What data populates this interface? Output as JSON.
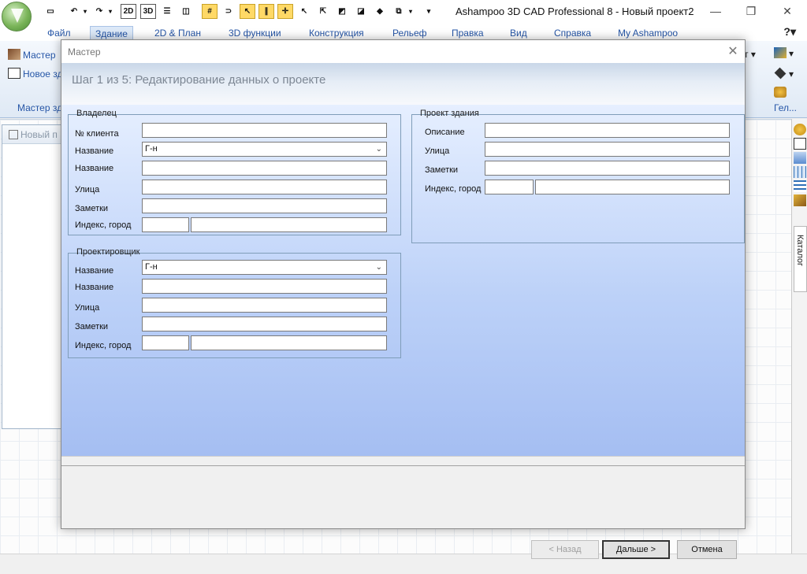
{
  "app": {
    "title": "Ashampoo 3D CAD Professional 8 - Новый проект2"
  },
  "quick_access": {
    "btn_2d": "2D",
    "btn_3d": "3D"
  },
  "ribbon": {
    "tabs": [
      "Файл",
      "Здание",
      "2D & План",
      "3D функции",
      "Конструкция",
      "Рельеф",
      "Правка",
      "Вид",
      "Справка",
      "My Ashampoo"
    ],
    "active_tab": "Здание",
    "items": {
      "master": "Мастер",
      "new": "Новое зд",
      "group_label": "Мастер зд",
      "right_group_label": "Гел..."
    }
  },
  "workspace": {
    "panel_title": "Новый п"
  },
  "sidebar": {
    "catalog_label": "Каталог"
  },
  "wizard": {
    "title": "Мастер",
    "heading": "Шаг 1 из 5: Редактирование данных о проекте",
    "owner": {
      "legend": "Владелец",
      "customer_no_label": "№ клиента",
      "salutation_label": "Название",
      "salutation_value": "Г-н",
      "name_label": "Название",
      "street_label": "Улица",
      "notes_label": "Заметки",
      "zip_city_label": "Индекс, город"
    },
    "designer": {
      "legend": "Проектировщик",
      "salutation_label": "Название",
      "salutation_value": "Г-н",
      "name_label": "Название",
      "street_label": "Улица",
      "notes_label": "Заметки",
      "zip_city_label": "Индекс, город"
    },
    "project": {
      "legend": "Проект здания",
      "description_label": "Описание",
      "street_label": "Улица",
      "notes_label": "Заметки",
      "zip_city_label": "Индекс, город"
    },
    "buttons": {
      "back": "< Назад",
      "next": "Дальше >",
      "cancel": "Отмена"
    }
  },
  "colors": {
    "accent": "#2656a7",
    "active_toolbar": "#ffd966",
    "wizard_body_top": "#e6efff",
    "wizard_body_bottom": "#a5bef2"
  }
}
